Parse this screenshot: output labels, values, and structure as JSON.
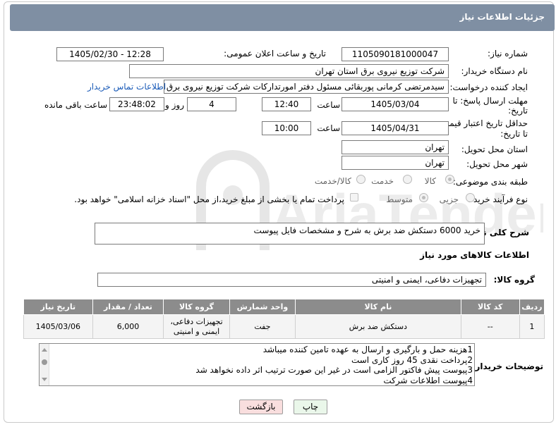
{
  "header": {
    "title": "جزئیات اطلاعات نیاز"
  },
  "fields": {
    "need_number_label": "شماره نیاز:",
    "need_number": "1105090181000047",
    "announce_label": "تاریخ و ساعت اعلان عمومی:",
    "announce_value": "1405/02/30 - 12:28",
    "buyer_org_label": "نام دستگاه خریدار:",
    "buyer_org": "شرکت توزیع نیروی برق استان تهران",
    "creator_label": "ایجاد کننده درخواست:",
    "creator": "سیدمرتضی کرمانی پوربقائی مسئول دفتر امورتدارکات شرکت توزیع نیروی برق ا",
    "contact_link": "اطلاعات تماس خریدار",
    "reply_deadline_label_1": "مهلت ارسال پاسخ: تا",
    "reply_deadline_label_2": "تاریخ:",
    "reply_date": "1405/03/04",
    "time_label": "ساعت",
    "reply_time": "12:40",
    "days_count": "4",
    "days_and_label": "روز و",
    "remaining_time": "23:48:02",
    "remaining_label": "ساعت باقی مانده",
    "price_deadline_label_1": "حداقل تاریخ اعتبار قیمت:",
    "price_deadline_label_2": "تا تاریخ:",
    "price_date": "1405/04/31",
    "price_time": "10:00",
    "province_label": "استان محل تحویل:",
    "province": "تهران",
    "city_label": "شهر محل تحویل:",
    "city": "تهران",
    "category_label": "طبقه بندی موضوعی:",
    "category_options": [
      "کالا",
      "خدمت",
      "کالا/خدمت"
    ],
    "category_selected": "کالا",
    "process_label": "نوع فرآیند خرید :",
    "process_options": [
      "جزیی",
      "متوسط"
    ],
    "process_selected": "متوسط",
    "payment_note": "پرداخت تمام یا بخشی از مبلغ خرید،از محل \"اسناد خزانه اسلامی\" خواهد بود.",
    "description_label": "شرح کلی نیاز:",
    "description": "خرید 6000 دستکش ضد برش به شرح و مشخصات فایل پیوست",
    "items_section_title": "اطلاعات کالاهای مورد نیاز",
    "goods_group_label": "گروه کالا:",
    "goods_group": "تجهیزات دفاعی، ایمنی و امنیتی"
  },
  "table": {
    "headers": [
      "ردیف",
      "کد کالا",
      "نام کالا",
      "واحد شمارش",
      "گروه کالا",
      "تعداد / مقدار",
      "تاریخ نیاز"
    ],
    "rows": [
      [
        "1",
        "--",
        "دستکش ضد برش",
        "جفت",
        "تجهیزات دفاعی، ایمنی و امنیتی",
        "6,000",
        "1405/03/06"
      ]
    ]
  },
  "notes": {
    "label": "توضیحات خریدار:",
    "lines": [
      "1هزینه حمل و بارگیری و ارسال به عهده تامین کننده میباشد",
      "2پرداخت نقدی 45 روز کاری است",
      "3پیوست پیش فاکتور الزامی است در غیر این صورت ترتیب اثر داده نخواهد شد",
      "4پیوست اطلاعات شرکت"
    ]
  },
  "buttons": {
    "print": "چاپ",
    "back": "بازگشت"
  },
  "watermark": {
    "text": "AriaTender.neT"
  },
  "colors": {
    "header_bg": "#7f8fa3",
    "table_header_bg": "#8c8c8c",
    "link": "#1a5bb8",
    "back_button_bg": "#f9dede",
    "print_button_bg": "#eaf7ea"
  }
}
